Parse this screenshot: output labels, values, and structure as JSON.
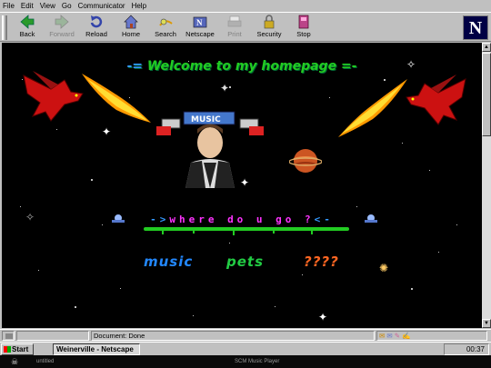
{
  "menu": [
    "File",
    "Edit",
    "View",
    "Go",
    "Communicator",
    "Help"
  ],
  "toolbar": {
    "buttons": [
      {
        "label": "Back",
        "icon": "back-arrow-icon",
        "disabled": false
      },
      {
        "label": "Forward",
        "icon": "forward-arrow-icon",
        "disabled": true
      },
      {
        "label": "Reload",
        "icon": "reload-icon",
        "disabled": false
      },
      {
        "label": "Home",
        "icon": "home-icon",
        "disabled": false
      },
      {
        "label": "Search",
        "icon": "search-icon",
        "disabled": false
      },
      {
        "label": "Netscape",
        "icon": "netscape-icon",
        "disabled": false
      },
      {
        "label": "Print",
        "icon": "print-icon",
        "disabled": true
      },
      {
        "label": "Security",
        "icon": "security-lock-icon",
        "disabled": false
      },
      {
        "label": "Stop",
        "icon": "stop-icon",
        "disabled": false
      }
    ],
    "logo": "N"
  },
  "page": {
    "welcome_left": "-=",
    "welcome_text": "Welcome to my homepage",
    "welcome_right": "=-",
    "nav_text": "where do u go ?",
    "links": {
      "music": "music",
      "pets": "pets",
      "qqqq": "????"
    }
  },
  "status": {
    "text": "Document: Done"
  },
  "taskbar": {
    "start": "Start",
    "task": "Weinerville - Netscape",
    "clock": "00:37"
  },
  "bottombar": {
    "left": "untitled",
    "center": "SCM Music Player"
  },
  "colors": {
    "page_bg": "#000000",
    "welcome": "#22cc22",
    "nav_bar": "#22cc22",
    "music": "#2288ff",
    "pets": "#22cc44",
    "qqqq": "#ff6622"
  }
}
